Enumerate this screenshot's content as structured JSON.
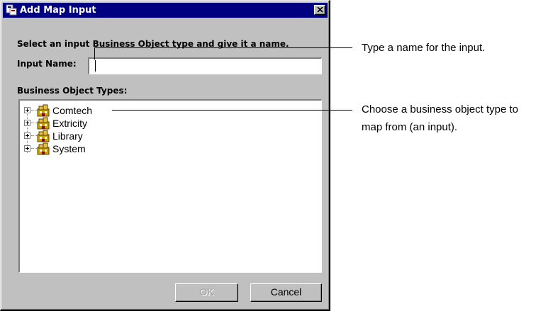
{
  "dialog": {
    "title": "Add Map Input",
    "instruction": "Select an input Business Object type and give it a name.",
    "input_name_label": "Input Name:",
    "input_name_value": "",
    "types_label": "Business Object Types:",
    "tree_items": [
      {
        "label": "Comtech",
        "icon": "business-object-folder-icon"
      },
      {
        "label": "Extricity",
        "icon": "business-object-folder-icon"
      },
      {
        "label": "Library",
        "icon": "business-object-folder-icon"
      },
      {
        "label": "System",
        "icon": "business-object-folder-icon"
      }
    ],
    "ok_label": "OK",
    "cancel_label": "Cancel"
  },
  "callouts": {
    "name": "Type a name for the input.",
    "type_line1": "Choose a business object type to",
    "type_line2": "map from (an input)."
  },
  "colors": {
    "titlebar": "#000080",
    "dialog_face": "#c0c0c0"
  }
}
